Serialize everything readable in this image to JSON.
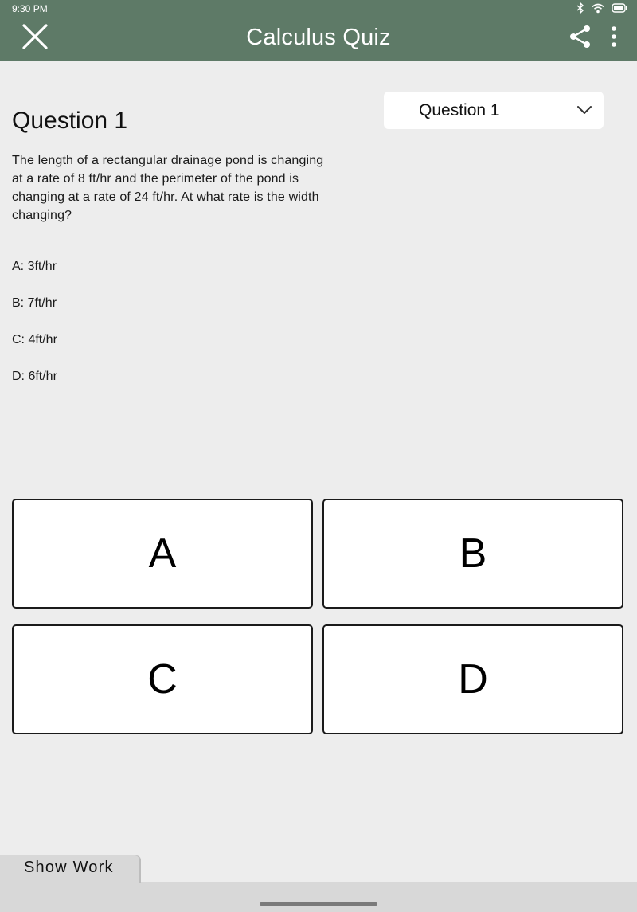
{
  "status_bar": {
    "time": "9:30 PM",
    "icons": [
      "bluetooth-icon",
      "wifi-icon",
      "battery-icon"
    ]
  },
  "app_bar": {
    "title": "Calculus Quiz",
    "icons": [
      "close-icon",
      "share-icon",
      "more-vert-icon"
    ]
  },
  "question": {
    "heading": "Question 1",
    "selector_value": "Question 1",
    "text": "The length of a rectangular drainage pond is changing at a rate of 8 ft/hr and the perimeter of the pond is changing at a rate of 24 ft/hr. At what rate is the width changing?",
    "choices": [
      "A: 3ft/hr",
      "B: 7ft/hr",
      "C: 4ft/hr",
      "D: 6ft/hr"
    ]
  },
  "answer_buttons": [
    "A",
    "B",
    "C",
    "D"
  ],
  "show_work_label": "Show Work",
  "colors": {
    "app_bar": "#5e7a67",
    "background": "#ededed",
    "panel": "#d8d8d8"
  }
}
